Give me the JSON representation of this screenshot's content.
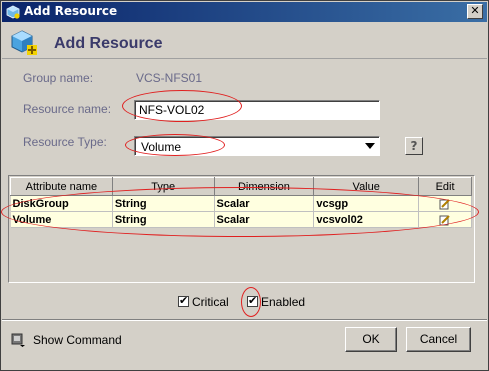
{
  "window": {
    "title": "Add Resource",
    "close_glyph": "✕"
  },
  "header": {
    "heading": "Add Resource"
  },
  "form": {
    "group_label": "Group name:",
    "group_value": "VCS-NFS01",
    "resource_name_label": "Resource name:",
    "resource_name_value": "NFS-VOL02",
    "resource_type_label": "Resource Type:",
    "resource_type_value": "Volume",
    "help_glyph": "?"
  },
  "table": {
    "columns": [
      "Attribute name",
      "Type",
      "Dimension",
      "Value",
      "Edit"
    ],
    "rows": [
      [
        "DiskGroup",
        "String",
        "Scalar",
        "vcsgp"
      ],
      [
        "Volume",
        "String",
        "Scalar",
        "vcsvol02"
      ]
    ]
  },
  "options": {
    "critical_label": "Critical",
    "enabled_label": "Enabled"
  },
  "footer": {
    "show_command_label": "Show Command",
    "ok_label": "OK",
    "cancel_label": "Cancel"
  },
  "icons": {
    "app": "resource-cube-icon",
    "header": "add-resource-icon",
    "edit": "edit-pencil-icon",
    "command": "command-icon"
  },
  "colors": {
    "titlebar": "#0a246a",
    "annotation": "#e02020",
    "row_highlight": "#ffffe0"
  }
}
